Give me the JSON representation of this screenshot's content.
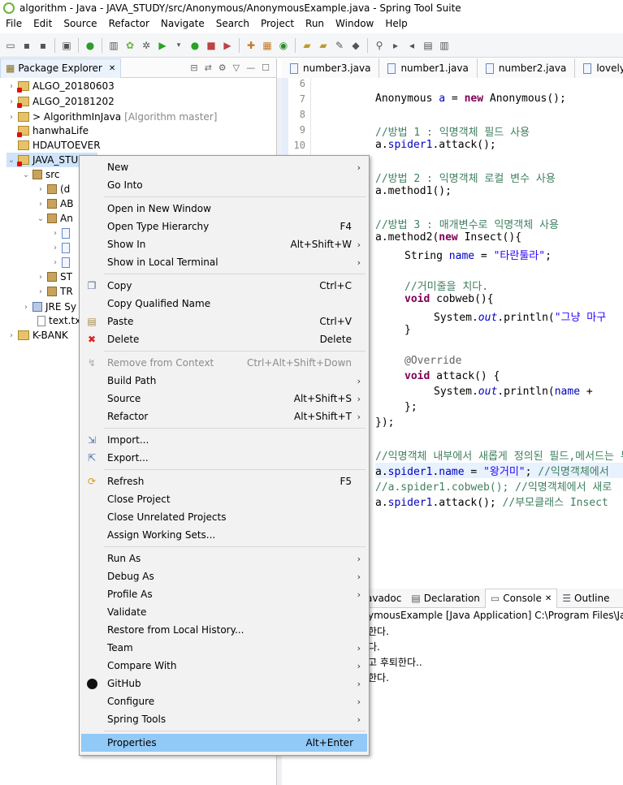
{
  "window": {
    "title": "algorithm - Java - JAVA_STUDY/src/Anonymous/AnonymousExample.java - Spring Tool Suite"
  },
  "menubar": [
    "File",
    "Edit",
    "Source",
    "Refactor",
    "Navigate",
    "Search",
    "Project",
    "Run",
    "Window",
    "Help"
  ],
  "package_explorer": {
    "title": "Package Explorer",
    "items": [
      {
        "label": "ALGO_20180603"
      },
      {
        "label": "ALGO_20181202"
      },
      {
        "label": "> AlgorithmInJava",
        "suffix": "[Algorithm master]"
      },
      {
        "label": "hanwhaLife"
      },
      {
        "label": "HDAUTOEVER"
      },
      {
        "label": "JAVA_STUDY"
      },
      {
        "label": "src"
      },
      {
        "label": "(d"
      },
      {
        "label": "AB"
      },
      {
        "label": "An"
      },
      {
        "label": ""
      },
      {
        "label": ""
      },
      {
        "label": ""
      },
      {
        "label": "ST"
      },
      {
        "label": "TR"
      },
      {
        "label": "JRE Sy"
      },
      {
        "label": "text.tx"
      },
      {
        "label": "K-BANK"
      }
    ]
  },
  "editor": {
    "tabs": [
      {
        "label": "number3.java"
      },
      {
        "label": "number1.java"
      },
      {
        "label": "number2.java"
      },
      {
        "label": "lovely"
      }
    ],
    "line_numbers": [
      "6",
      "7",
      "8",
      "9",
      "10"
    ]
  },
  "console": {
    "tabs": [
      {
        "label": "avadoc"
      },
      {
        "label": "Declaration"
      },
      {
        "label": "Console"
      },
      {
        "label": "Outline"
      }
    ],
    "header": "ymousExample [Java Application] C:\\Program Files\\Java\\",
    "lines": [
      "한다.",
      "다.",
      "고 후퇴한다..",
      "한다."
    ]
  },
  "context_menu": {
    "items": [
      {
        "label": "New",
        "submenu": true
      },
      {
        "label": "Go Into"
      },
      {
        "label": "Open in New Window"
      },
      {
        "label": "Open Type Hierarchy",
        "shortcut": "F4"
      },
      {
        "label": "Show In",
        "shortcut": "Alt+Shift+W",
        "submenu": true
      },
      {
        "label": "Show in Local Terminal",
        "submenu": true
      },
      {
        "label": "Copy",
        "shortcut": "Ctrl+C",
        "icon": "copy-icon"
      },
      {
        "label": "Copy Qualified Name"
      },
      {
        "label": "Paste",
        "shortcut": "Ctrl+V",
        "icon": "paste-icon"
      },
      {
        "label": "Delete",
        "shortcut": "Delete",
        "icon": "delete-icon"
      },
      {
        "label": "Remove from Context",
        "shortcut": "Ctrl+Alt+Shift+Down",
        "disabled": true
      },
      {
        "label": "Build Path",
        "submenu": true
      },
      {
        "label": "Source",
        "shortcut": "Alt+Shift+S",
        "submenu": true
      },
      {
        "label": "Refactor",
        "shortcut": "Alt+Shift+T",
        "submenu": true
      },
      {
        "label": "Import...",
        "icon": "import-icon"
      },
      {
        "label": "Export...",
        "icon": "export-icon"
      },
      {
        "label": "Refresh",
        "shortcut": "F5",
        "icon": "refresh-icon"
      },
      {
        "label": "Close Project"
      },
      {
        "label": "Close Unrelated Projects"
      },
      {
        "label": "Assign Working Sets..."
      },
      {
        "label": "Run As",
        "submenu": true
      },
      {
        "label": "Debug As",
        "submenu": true
      },
      {
        "label": "Profile As",
        "submenu": true
      },
      {
        "label": "Validate"
      },
      {
        "label": "Restore from Local History..."
      },
      {
        "label": "Team",
        "submenu": true
      },
      {
        "label": "Compare With",
        "submenu": true
      },
      {
        "label": "GitHub",
        "submenu": true,
        "icon": "github-icon"
      },
      {
        "label": "Configure",
        "submenu": true
      },
      {
        "label": "Spring Tools",
        "submenu": true
      },
      {
        "label": "Properties",
        "shortcut": "Alt+Enter",
        "highlighted": true
      }
    ]
  },
  "colors": {
    "highlight": "#91c9f7",
    "keyword": "#7f0055",
    "comment": "#3f7f5f",
    "field": "#0000c0",
    "string": "#2a00ff"
  }
}
